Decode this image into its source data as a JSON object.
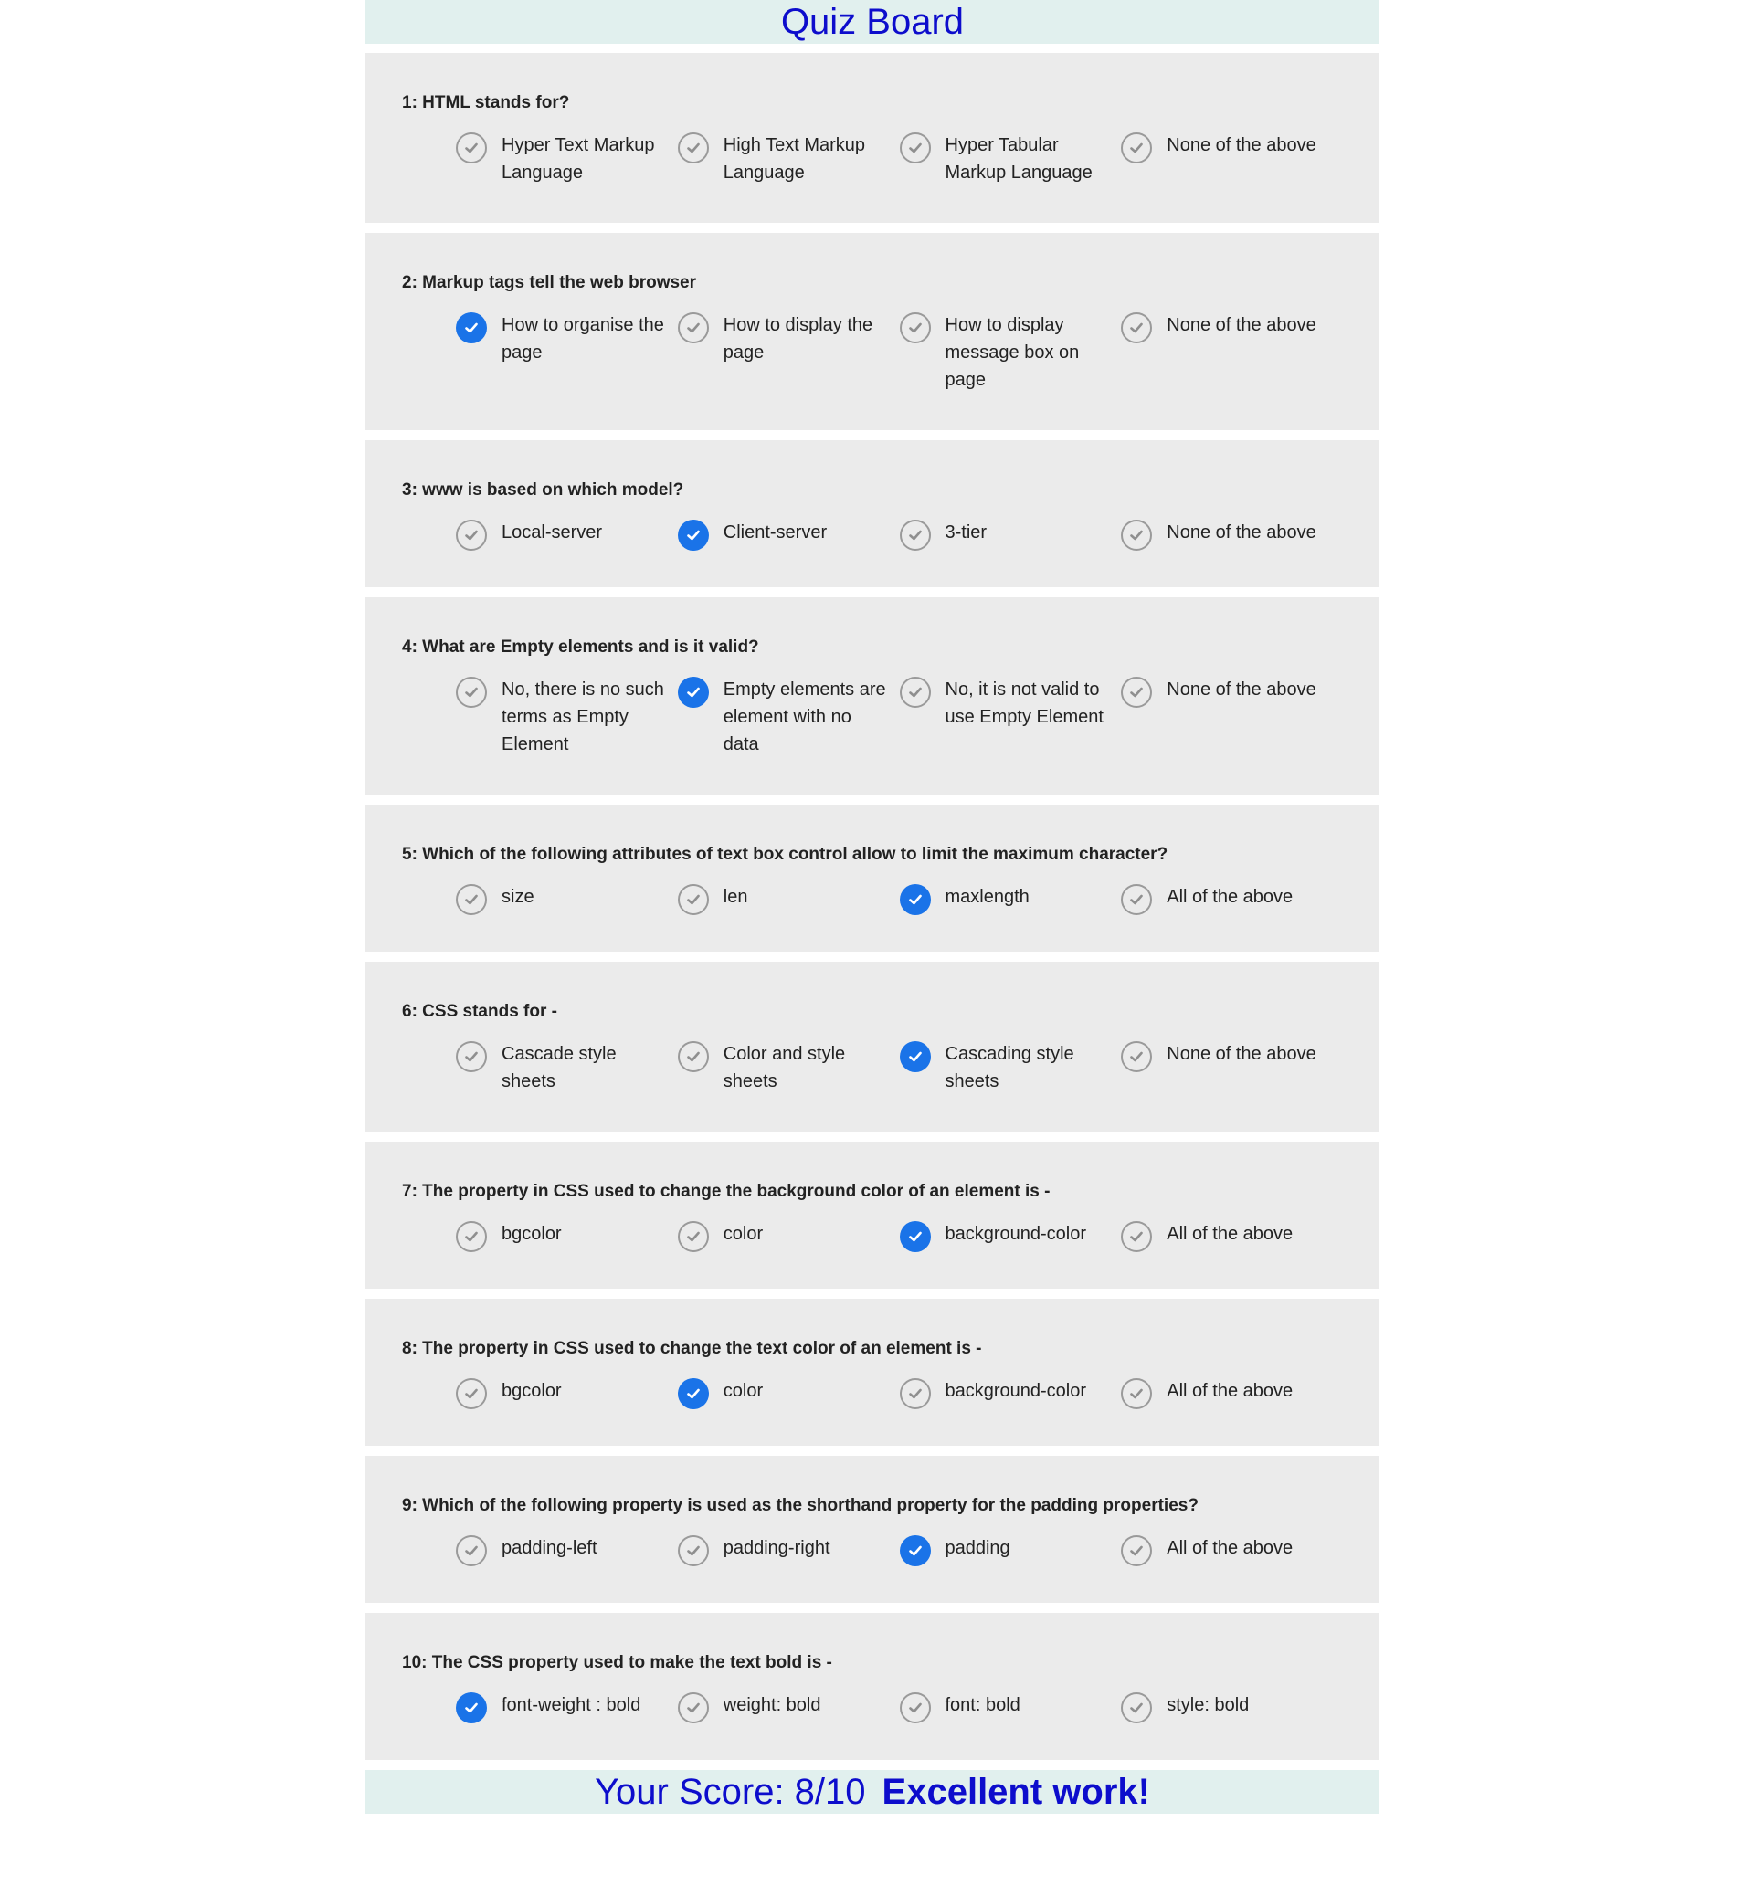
{
  "header": {
    "title": "Quiz Board"
  },
  "questions": [
    {
      "title": "1: HTML stands for?",
      "options": [
        "Hyper Text Markup Language",
        "High Text Markup Language",
        "Hyper Tabular Markup Language",
        "None of the above"
      ],
      "selected": -1
    },
    {
      "title": "2: Markup tags tell the web browser",
      "options": [
        "How to organise the page",
        "How to display the page",
        "How to display message box on page",
        "None of the above"
      ],
      "selected": 0
    },
    {
      "title": "3: www is based on which model?",
      "options": [
        "Local-server",
        "Client-server",
        "3-tier",
        "None of the above"
      ],
      "selected": 1
    },
    {
      "title": "4: What are Empty elements and is it valid?",
      "options": [
        "No, there is no such terms as Empty Element",
        "Empty elements are element with no data",
        "No, it is not valid to use Empty Element",
        "None of the above"
      ],
      "selected": 1
    },
    {
      "title": "5: Which of the following attributes of text box control allow to limit the maximum character?",
      "options": [
        "size",
        "len",
        "maxlength",
        "All of the above"
      ],
      "selected": 2
    },
    {
      "title": "6: CSS stands for -",
      "options": [
        "Cascade style sheets",
        "Color and style sheets",
        "Cascading style sheets",
        "None of the above"
      ],
      "selected": 2
    },
    {
      "title": "7: The property in CSS used to change the background color of an element is -",
      "options": [
        "bgcolor",
        "color",
        "background-color",
        "All of the above"
      ],
      "selected": 2
    },
    {
      "title": "8: The property in CSS used to change the text color of an element is -",
      "options": [
        "bgcolor",
        "color",
        "background-color",
        "All of the above"
      ],
      "selected": 1
    },
    {
      "title": "9: Which of the following property is used as the shorthand property for the padding properties?",
      "options": [
        "padding-left",
        "padding-right",
        "padding",
        "All of the above"
      ],
      "selected": 2
    },
    {
      "title": "10: The CSS property used to make the text bold is -",
      "options": [
        "font-weight : bold",
        "weight: bold",
        "font: bold",
        "style: bold"
      ],
      "selected": 0
    }
  ],
  "footer": {
    "score": "Your Score: 8/10",
    "message": "Excellent work!"
  },
  "colors": {
    "accent": "#1a73e8",
    "title": "#0d0dcc",
    "banner": "#e1f0ee",
    "card": "#ebebeb"
  }
}
